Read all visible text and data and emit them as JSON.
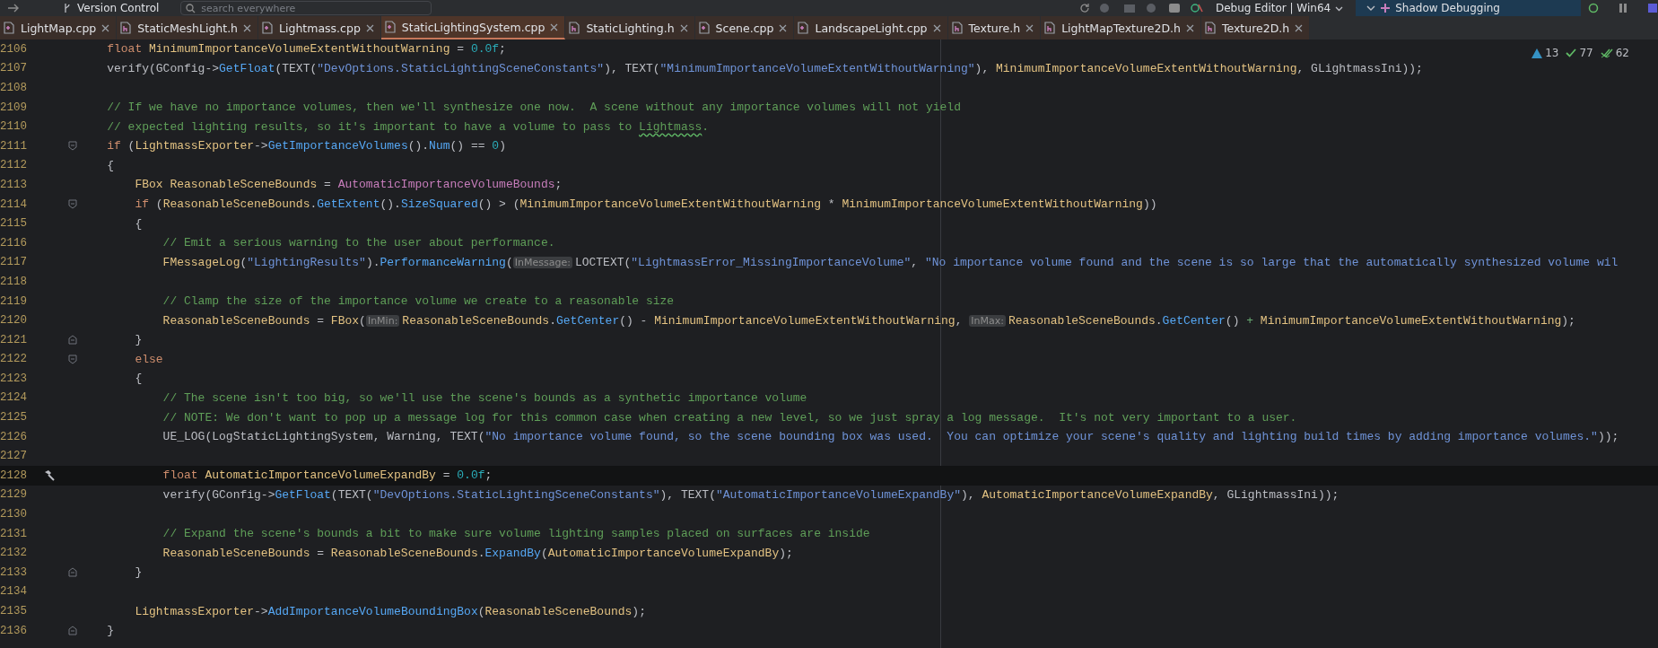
{
  "toolbar": {
    "vcs_label": "Version Control",
    "search": {
      "placeholder": "search everywhere"
    },
    "run_config": "Debug Editor | Win64",
    "run_target": "Shadow Debugging"
  },
  "tabs": [
    {
      "label": "LightMap.cpp",
      "kind": "cpp",
      "selected": false
    },
    {
      "label": "StaticMeshLight.h",
      "kind": "h",
      "selected": false
    },
    {
      "label": "Lightmass.cpp",
      "kind": "cpp",
      "selected": false
    },
    {
      "label": "StaticLightingSystem.cpp",
      "kind": "cpp",
      "selected": true
    },
    {
      "label": "StaticLighting.h",
      "kind": "h",
      "selected": false
    },
    {
      "label": "Scene.cpp",
      "kind": "cpp",
      "selected": false
    },
    {
      "label": "LandscapeLight.cpp",
      "kind": "cpp",
      "selected": false
    },
    {
      "label": "Texture.h",
      "kind": "h",
      "selected": false
    },
    {
      "label": "LightMapTexture2D.h",
      "kind": "h",
      "selected": false
    },
    {
      "label": "Texture2D.h",
      "kind": "h",
      "selected": false
    }
  ],
  "inspections": [
    {
      "kind": "warning",
      "count": "13"
    },
    {
      "kind": "check",
      "count": "77"
    },
    {
      "kind": "double-check",
      "count": "62"
    }
  ],
  "lines": [
    {
      "number": "2106",
      "current": false,
      "tokens": [
        {
          "kind": "kw",
          "text": "    float "
        },
        {
          "kind": "var",
          "text": "MinimumImportanceVolumeExtentWithoutWarning"
        },
        {
          "kind": "p",
          "text": " = "
        },
        {
          "kind": "num",
          "text": "0.0f"
        },
        {
          "kind": "p",
          "text": ";"
        }
      ]
    },
    {
      "number": "2107",
      "current": false,
      "tokens": [
        {
          "kind": "p",
          "text": "    verify(GConfig->"
        },
        {
          "kind": "fn",
          "text": "GetFloat"
        },
        {
          "kind": "p",
          "text": "(TEXT("
        },
        {
          "kind": "str",
          "text": "\"DevOptions.StaticLightingSceneConstants\""
        },
        {
          "kind": "p",
          "text": "), TEXT("
        },
        {
          "kind": "str",
          "text": "\"MinimumImportanceVolumeExtentWithoutWarning\""
        },
        {
          "kind": "p",
          "text": "), "
        },
        {
          "kind": "var",
          "text": "MinimumImportanceVolumeExtentWithoutWarning"
        },
        {
          "kind": "p",
          "text": ", GLightmassIni));"
        }
      ]
    },
    {
      "number": "2108",
      "current": false
    },
    {
      "number": "2109",
      "current": false,
      "tokens": [
        {
          "kind": "cm",
          "text": "    // If we have no importance volumes, then we'll synthesize one now.  A scene without any importance volumes will not yield"
        }
      ]
    },
    {
      "number": "2110",
      "current": false,
      "tokens": [
        {
          "kind": "cm",
          "text": "    // expected lighting results, so it's important to have a volume to pass to "
        },
        {
          "kind": "typo",
          "text": "Lightmass"
        },
        {
          "kind": "cm",
          "text": "."
        }
      ]
    },
    {
      "number": "2111",
      "current": false,
      "fold": {
        "kind": "start"
      },
      "tokens": [
        {
          "kind": "kw",
          "text": "    if"
        },
        {
          "kind": "p",
          "text": " ("
        },
        {
          "kind": "var",
          "text": "LightmassExporter"
        },
        {
          "kind": "p",
          "text": "->"
        },
        {
          "kind": "fn",
          "text": "GetImportanceVolumes"
        },
        {
          "kind": "p",
          "text": "()."
        },
        {
          "kind": "fn",
          "text": "Num"
        },
        {
          "kind": "p",
          "text": "() == "
        },
        {
          "kind": "num",
          "text": "0"
        },
        {
          "kind": "p",
          "text": ")"
        }
      ]
    },
    {
      "number": "2112",
      "current": false,
      "tokens": [
        {
          "kind": "p",
          "text": "    {"
        }
      ]
    },
    {
      "number": "2113",
      "current": false,
      "tokens": [
        {
          "kind": "type",
          "text": "        FBox "
        },
        {
          "kind": "var",
          "text": "ReasonableSceneBounds"
        },
        {
          "kind": "p",
          "text": " = "
        },
        {
          "kind": "glob",
          "text": "AutomaticImportanceVolumeBounds"
        },
        {
          "kind": "p",
          "text": ";"
        }
      ]
    },
    {
      "number": "2114",
      "current": false,
      "fold": {
        "kind": "start"
      },
      "tokens": [
        {
          "kind": "kw",
          "text": "        if"
        },
        {
          "kind": "p",
          "text": " ("
        },
        {
          "kind": "var",
          "text": "ReasonableSceneBounds"
        },
        {
          "kind": "p",
          "text": "."
        },
        {
          "kind": "fn",
          "text": "GetExtent"
        },
        {
          "kind": "p",
          "text": "()."
        },
        {
          "kind": "fn",
          "text": "SizeSquared"
        },
        {
          "kind": "p",
          "text": "() > ("
        },
        {
          "kind": "var",
          "text": "MinimumImportanceVolumeExtentWithoutWarning"
        },
        {
          "kind": "p",
          "text": " * "
        },
        {
          "kind": "var",
          "text": "MinimumImportanceVolumeExtentWithoutWarning"
        },
        {
          "kind": "p",
          "text": "))"
        }
      ]
    },
    {
      "number": "2115",
      "current": false,
      "tokens": [
        {
          "kind": "p",
          "text": "        {"
        }
      ]
    },
    {
      "number": "2116",
      "current": false,
      "tokens": [
        {
          "kind": "cm",
          "text": "            // Emit a serious warning to the user about performance."
        }
      ]
    },
    {
      "number": "2117",
      "current": false,
      "tokens": [
        {
          "kind": "type",
          "text": "            FMessageLog"
        },
        {
          "kind": "p",
          "text": "("
        },
        {
          "kind": "str",
          "text": "\"LightingResults\""
        },
        {
          "kind": "p",
          "text": ")."
        },
        {
          "kind": "fn",
          "text": "PerformanceWarning"
        },
        {
          "kind": "p",
          "text": "("
        },
        {
          "kind": "hint",
          "text": "InMessage:"
        },
        {
          "kind": "p",
          "text": "LOCTEXT("
        },
        {
          "kind": "str",
          "text": "\"LightmassError_MissingImportanceVolume\""
        },
        {
          "kind": "p",
          "text": ", "
        },
        {
          "kind": "str",
          "text": "\"No importance volume found and the scene is so large that the automatically synthesized volume wil"
        }
      ]
    },
    {
      "number": "2118",
      "current": false
    },
    {
      "number": "2119",
      "current": false,
      "tokens": [
        {
          "kind": "cm",
          "text": "            // Clamp the size of the importance volume we create to a reasonable size"
        }
      ]
    },
    {
      "number": "2120",
      "current": false,
      "tokens": [
        {
          "kind": "var",
          "text": "            ReasonableSceneBounds"
        },
        {
          "kind": "p",
          "text": " = "
        },
        {
          "kind": "type",
          "text": "FBox"
        },
        {
          "kind": "p",
          "text": "("
        },
        {
          "kind": "hint",
          "text": "InMin:"
        },
        {
          "kind": "var",
          "text": "ReasonableSceneBounds"
        },
        {
          "kind": "p",
          "text": "."
        },
        {
          "kind": "fn",
          "text": "GetCenter"
        },
        {
          "kind": "p",
          "text": "() - "
        },
        {
          "kind": "var",
          "text": "MinimumImportanceVolumeExtentWithoutWarning"
        },
        {
          "kind": "p",
          "text": ", "
        },
        {
          "kind": "hint",
          "text": "InMax:"
        },
        {
          "kind": "var",
          "text": "ReasonableSceneBounds"
        },
        {
          "kind": "p",
          "text": "."
        },
        {
          "kind": "fn",
          "text": "GetCenter"
        },
        {
          "kind": "p",
          "text": "() "
        },
        {
          "kind": "op",
          "text": "+"
        },
        {
          "kind": "var",
          "text": " MinimumImportanceVolumeExtentWithoutWarning"
        },
        {
          "kind": "p",
          "text": ");"
        }
      ]
    },
    {
      "number": "2121",
      "current": false,
      "fold": {
        "kind": "end"
      },
      "tokens": [
        {
          "kind": "p",
          "text": "        }"
        }
      ]
    },
    {
      "number": "2122",
      "current": false,
      "fold": {
        "kind": "start"
      },
      "tokens": [
        {
          "kind": "kw",
          "text": "        else"
        }
      ]
    },
    {
      "number": "2123",
      "current": false,
      "tokens": [
        {
          "kind": "p",
          "text": "        {"
        }
      ]
    },
    {
      "number": "2124",
      "current": false,
      "tokens": [
        {
          "kind": "cm",
          "text": "            // The scene isn't too big, so we'll use the scene's bounds as a synthetic importance volume"
        }
      ]
    },
    {
      "number": "2125",
      "current": false,
      "tokens": [
        {
          "kind": "cm",
          "text": "            // NOTE: We don't want to pop up a message log for this common case when creating a new level, so we just spray a log message.  It's not very important to a user."
        }
      ]
    },
    {
      "number": "2126",
      "current": false,
      "tokens": [
        {
          "kind": "p",
          "text": "            UE_LOG(LogStaticLightingSystem, Warning, TEXT("
        },
        {
          "kind": "str",
          "text": "\"No importance volume found, so the scene bounding box was used.  You can optimize your scene's quality and lighting build times by adding importance volumes.\""
        },
        {
          "kind": "p",
          "text": "));"
        }
      ]
    },
    {
      "number": "2127",
      "current": false
    },
    {
      "number": "2128",
      "current": true,
      "gutter_icon": {
        "kind": "hammer"
      },
      "tokens": [
        {
          "kind": "kw",
          "text": "            float "
        },
        {
          "kind": "var",
          "text": "AutomaticImportanceVolumeExpandBy"
        },
        {
          "kind": "p",
          "text": " = "
        },
        {
          "kind": "num",
          "text": "0.0f"
        },
        {
          "kind": "p",
          "text": ";"
        }
      ]
    },
    {
      "number": "2129",
      "current": false,
      "tokens": [
        {
          "kind": "p",
          "text": "            verify(GConfig->"
        },
        {
          "kind": "fn",
          "text": "GetFloat"
        },
        {
          "kind": "p",
          "text": "(TEXT("
        },
        {
          "kind": "str",
          "text": "\"DevOptions.StaticLightingSceneConstants\""
        },
        {
          "kind": "p",
          "text": "), TEXT("
        },
        {
          "kind": "str",
          "text": "\"AutomaticImportanceVolumeExpandBy\""
        },
        {
          "kind": "p",
          "text": "), "
        },
        {
          "kind": "var",
          "text": "AutomaticImportanceVolumeExpandBy"
        },
        {
          "kind": "p",
          "text": ", GLightmassIni));"
        }
      ]
    },
    {
      "number": "2130",
      "current": false
    },
    {
      "number": "2131",
      "current": false,
      "tokens": [
        {
          "kind": "cm",
          "text": "            // Expand the scene's bounds a bit to make sure volume lighting samples placed on surfaces are inside"
        }
      ]
    },
    {
      "number": "2132",
      "current": false,
      "tokens": [
        {
          "kind": "var",
          "text": "            ReasonableSceneBounds"
        },
        {
          "kind": "p",
          "text": " = "
        },
        {
          "kind": "var",
          "text": "ReasonableSceneBounds"
        },
        {
          "kind": "p",
          "text": "."
        },
        {
          "kind": "fn",
          "text": "ExpandBy"
        },
        {
          "kind": "p",
          "text": "("
        },
        {
          "kind": "var",
          "text": "AutomaticImportanceVolumeExpandBy"
        },
        {
          "kind": "p",
          "text": ");"
        }
      ]
    },
    {
      "number": "2133",
      "current": false,
      "fold": {
        "kind": "end"
      },
      "tokens": [
        {
          "kind": "p",
          "text": "        }"
        }
      ]
    },
    {
      "number": "2134",
      "current": false
    },
    {
      "number": "2135",
      "current": false,
      "tokens": [
        {
          "kind": "var",
          "text": "        LightmassExporter"
        },
        {
          "kind": "p",
          "text": "->"
        },
        {
          "kind": "fn",
          "text": "AddImportanceVolumeBoundingBox"
        },
        {
          "kind": "p",
          "text": "("
        },
        {
          "kind": "var",
          "text": "ReasonableSceneBounds"
        },
        {
          "kind": "p",
          "text": ");"
        }
      ]
    },
    {
      "number": "2136",
      "current": false,
      "fold": {
        "kind": "end"
      },
      "tokens": [
        {
          "kind": "p",
          "text": "    }"
        }
      ]
    }
  ]
}
